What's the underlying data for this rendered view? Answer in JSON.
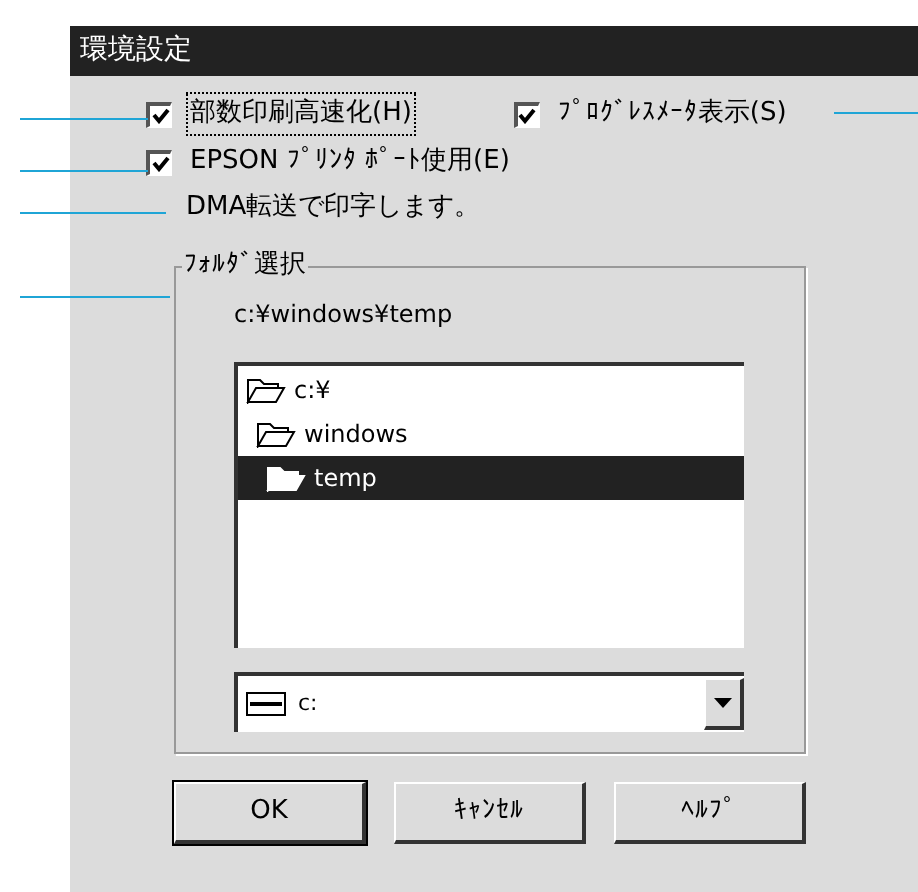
{
  "window": {
    "title": "環境設定"
  },
  "options": [
    {
      "label": "部数印刷高速化(H)",
      "checked": true,
      "focused": true
    },
    {
      "label": "ﾌﾟﾛｸﾞﾚｽﾒｰﾀ表示(S)",
      "checked": true,
      "focused": false
    },
    {
      "label": "EPSON ﾌﾟﾘﾝﾀ ﾎﾟｰﾄ使用(E)",
      "checked": true,
      "focused": false
    }
  ],
  "note": "DMA転送で印字します。",
  "folder_group": {
    "title": "ﾌｫﾙﾀﾞ選択",
    "path": "c:¥windows¥temp",
    "folders": [
      {
        "name": "c:¥",
        "selected": false,
        "children": [
          {
            "name": "windows",
            "selected": false,
            "children": [
              {
                "name": "temp",
                "selected": true
              }
            ]
          }
        ]
      }
    ],
    "drive": "c:"
  },
  "buttons": [
    {
      "label": "OK",
      "default": true
    },
    {
      "label": "ｷｬﾝｾﾙ",
      "default": false
    },
    {
      "label": "ﾍﾙﾌﾟ",
      "default": false
    }
  ]
}
